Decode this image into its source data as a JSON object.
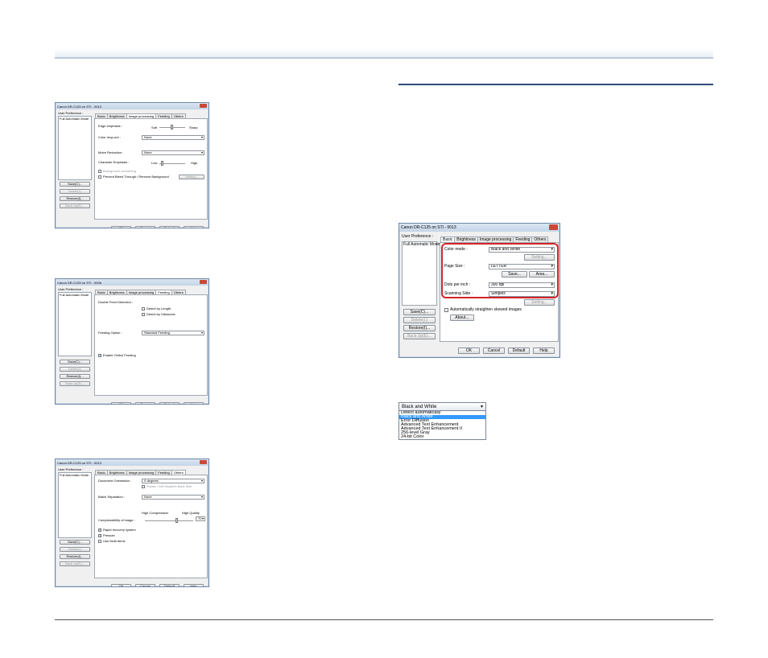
{
  "dialog_title": "Canon DR-C125 on STI - 0013",
  "dialog_title_alt": "Canon DR-C125 on STI - 0006",
  "user_pref_label": "User Preference :",
  "user_pref_item": "Full Automatic Mode",
  "side_buttons": {
    "save": "Save(C)...",
    "delete": "Delete(L)",
    "restore": "Restore(I)...",
    "backup": "Back Up(E)..."
  },
  "bottom_buttons": {
    "ok": "OK",
    "cancel": "Cancel",
    "default": "Default",
    "help": "Help"
  },
  "tabs": {
    "basic": "Basic",
    "brightness": "Brightness",
    "image_processing": "Image processing",
    "feeding": "Feeding",
    "others": "Others"
  },
  "dlg1": {
    "edge_label": "Edge emphasis :",
    "soft": "Soft",
    "sharp": "Sharp",
    "color_drop_label": "Color drop-out :",
    "color_drop_value": "None",
    "moire_label": "Moire Reduction :",
    "moire_value": "None",
    "char_emph_label": "Character Emphasis :",
    "low": "Low",
    "high": "High",
    "bg_smooth": "Background smoothing",
    "prevent_bleed": "Prevent Bleed Through / Remove Background",
    "setting": "Setting..."
  },
  "dlg2": {
    "double_feed_label": "Double Feed Detection :",
    "detect_length": "Detect by Length",
    "detect_ultrasonic": "Detect by Ultrasonic",
    "feeding_option_label": "Feeding Option :",
    "feeding_option_value": "Standard Feeding",
    "rapid_recovery": "Enable Online Feeding"
  },
  "dlg3": {
    "doc_orient_label": "Document Orientation :",
    "doc_orient_value": "0 degrees",
    "rotate_back": "Rotate +180 degrees Back Side",
    "batch_sep_label": "Batch Separation :",
    "batch_sep_value": "None",
    "high_compression": "High Compression",
    "high_quality": "High Quality",
    "compress_label": "Compressibility of image :",
    "compress_value": "70",
    "rapid_recovery": "Rapid recovery system",
    "prescan": "Prescan",
    "verify_count": "Use Multi Items"
  },
  "dlg4": {
    "color_mode_label": "Color mode :",
    "color_mode_value": "Black and White",
    "setting": "Setting...",
    "page_size_label": "Page Size :",
    "page_size_value": "LETTER",
    "save_btn": "Save...",
    "area_btn": "Area...",
    "dpi_label": "Dots per inch :",
    "dpi_value": "300 dpi",
    "scan_side_label": "Scanning Side :",
    "scan_side_value": "Simplex",
    "setting2": "Setting...",
    "auto_straighten": "Automatically straighten skewed images",
    "about_btn": "About..."
  },
  "dropdown": {
    "selected": "Black and White",
    "options": [
      "Detect automatically",
      "Black and White",
      "Error Diffusion",
      "Advanced Text Enhancement",
      "Advanced Text Enhancement II",
      "256-level Gray",
      "24-bit Color"
    ]
  },
  "colors": {
    "header_rule": "#2e4a7a",
    "highlight_box": "#d2252a",
    "selection": "#3399ff"
  }
}
